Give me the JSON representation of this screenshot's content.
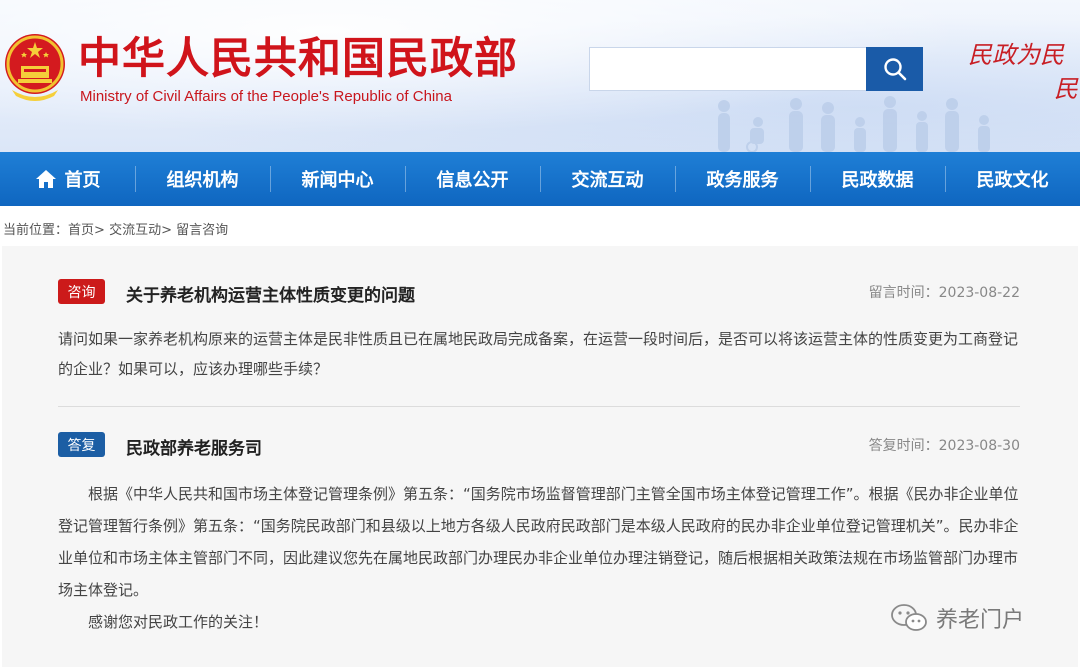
{
  "header": {
    "title": "中华人民共和国民政部",
    "subtitle": "Ministry of Civil Affairs of the People's Republic of China",
    "search_placeholder": "",
    "slogan_line1": "民政为民",
    "slogan_line2": "民",
    "brand_red": "#d0141b",
    "brand_blue": "#1a5ba8"
  },
  "nav": {
    "items": [
      {
        "label": "首页",
        "icon": "home-icon"
      },
      {
        "label": "组织机构"
      },
      {
        "label": "新闻中心"
      },
      {
        "label": "信息公开"
      },
      {
        "label": "交流互动"
      },
      {
        "label": "政务服务"
      },
      {
        "label": "民政数据"
      },
      {
        "label": "民政文化"
      }
    ],
    "color": "#1170c9"
  },
  "breadcrumb": {
    "prefix": "当前位置：",
    "home": "首页",
    "sep1": ">",
    "section": "交流互动",
    "sep2": ">",
    "current": "留言咨询"
  },
  "question": {
    "tag": "咨询",
    "title": "关于养老机构运营主体性质变更的问题",
    "time_label": "留言时间：",
    "time": "2023-08-22",
    "body": "请问如果一家养老机构原来的运营主体是民非性质且已在属地民政局完成备案，在运营一段时间后，是否可以将该运营主体的性质变更为工商登记的企业？如果可以，应该办理哪些手续？"
  },
  "answer": {
    "tag": "答复",
    "title": "民政部养老服务司",
    "time_label": "答复时间：",
    "time": "2023-08-30",
    "para1": "根据《中华人民共和国市场主体登记管理条例》第五条：“国务院市场监督管理部门主管全国市场主体登记管理工作”。根据《民办非企业单位登记管理暂行条例》第五条：“国务院民政部门和县级以上地方各级人民政府民政部门是本级人民政府的民办非企业单位登记管理机关”。民办非企业单位和市场主体主管部门不同，因此建议您先在属地民政部门办理民办非企业单位办理注销登记，随后根据相关政策法规在市场监管部门办理市场主体登记。",
    "para2": "感谢您对民政工作的关注！"
  },
  "watermark": {
    "text": "养老门户",
    "icon": "wechat-icon"
  }
}
